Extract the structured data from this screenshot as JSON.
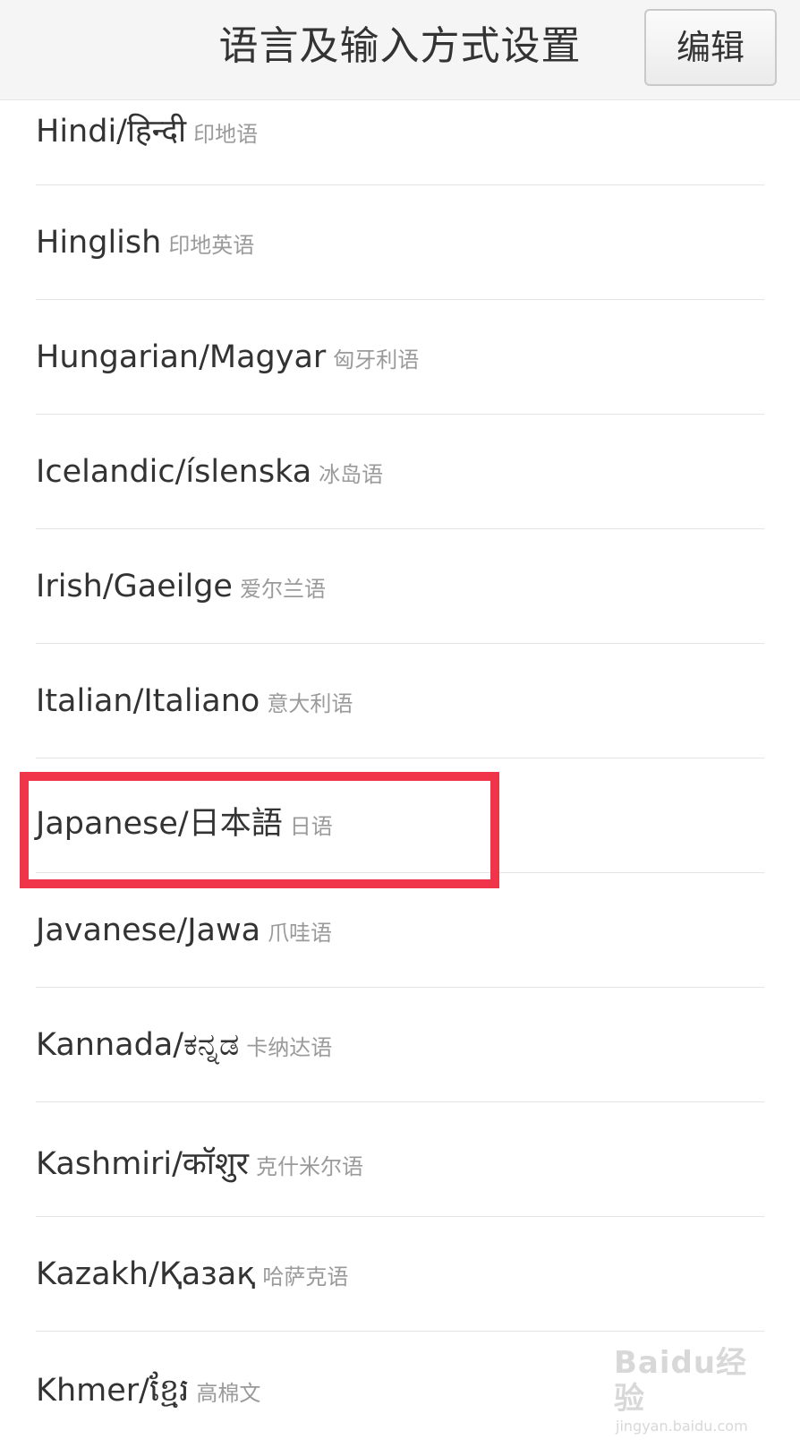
{
  "header": {
    "title": "语言及输入方式设置",
    "edit_label": "编辑"
  },
  "languages": [
    {
      "name": "Hindi/हिन्दी",
      "cn": "印地语"
    },
    {
      "name": "Hinglish",
      "cn": "印地英语"
    },
    {
      "name": "Hungarian/Magyar",
      "cn": "匈牙利语"
    },
    {
      "name": "Icelandic/íslenska",
      "cn": "冰岛语"
    },
    {
      "name": "Irish/Gaeilge",
      "cn": "爱尔兰语"
    },
    {
      "name": "Italian/Italiano",
      "cn": "意大利语"
    },
    {
      "name": "Japanese/日本語",
      "cn": "日语"
    },
    {
      "name": "Javanese/Jawa",
      "cn": "爪哇语"
    },
    {
      "name": "Kannada/ಕನ್ನಡ",
      "cn": "卡纳达语"
    },
    {
      "name": "Kashmiri/कॉशुर",
      "cn": "克什米尔语"
    },
    {
      "name": "Kazakh/Қазақ",
      "cn": "哈萨克语"
    },
    {
      "name": "Khmer/ខ្មែរ",
      "cn": "高棉文"
    }
  ],
  "highlighted_language_index": 6,
  "highlight_color": "#f0354a",
  "watermark": {
    "logo": "Baidu经验",
    "url": "jingyan.baidu.com"
  }
}
